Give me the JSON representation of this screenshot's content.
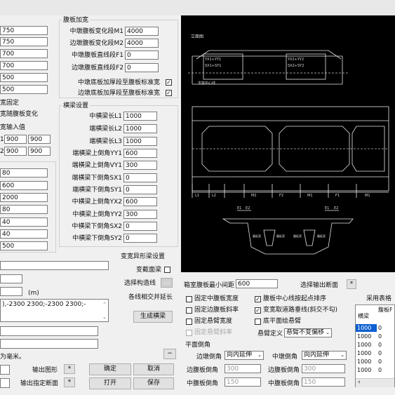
{
  "left_inputs": [
    "750",
    "750",
    "700",
    "700",
    "500",
    "500"
  ],
  "left_labels": {
    "fixed_width": "宽固定",
    "width_follow": "宽随腹板变化",
    "width_input": "宽输入值",
    "row1_prefix": "1",
    "row2_prefix": "2"
  },
  "width_pairs": [
    [
      "900",
      "900"
    ],
    [
      "900",
      "900"
    ]
  ],
  "left_column_inputs": [
    "80",
    "600",
    "2000",
    "80",
    "40",
    "40",
    "500"
  ],
  "web_haunch": {
    "title": "腹板加宽",
    "rows": [
      {
        "label": "中墩腹板变化段M1",
        "value": "4000"
      },
      {
        "label": "边墩腹板变化段M2",
        "value": "4000"
      },
      {
        "label": "中墩腹板直线段F1",
        "value": "0"
      },
      {
        "label": "边墩腹板直线段F2",
        "value": "0"
      }
    ],
    "checks": [
      {
        "label": "中墩底板加厚段至腹板标准宽",
        "checked": "✓"
      },
      {
        "label": "边墩底板加厚段至腹板标准宽",
        "checked": "✓"
      }
    ]
  },
  "diaphragm": {
    "title": "横梁设置",
    "rows": [
      {
        "label": "中横梁长L1",
        "value": "1000"
      },
      {
        "label": "端横梁长L2",
        "value": "1000"
      },
      {
        "label": "端横梁长L3",
        "value": "1000"
      },
      {
        "label": "端横梁上倒角YY1",
        "value": "600"
      },
      {
        "label": "端横梁上倒角VY1",
        "value": "300"
      },
      {
        "label": "端横梁下倒角SX1",
        "value": "0"
      },
      {
        "label": "端横梁下倒角SY1",
        "value": "0"
      },
      {
        "label": "中横梁上倒角YX2",
        "value": "600"
      },
      {
        "label": "中横梁上倒角YY2",
        "value": "300"
      },
      {
        "label": "中横梁下倒角SX2",
        "value": "0"
      },
      {
        "label": "中横梁下倒角SY2",
        "value": "0"
      }
    ]
  },
  "variable_section": {
    "title": "变宽异形梁设置",
    "cross_section_label": "变截面梁",
    "select_line_label": "选择构造线",
    "select_line_btn": "...",
    "extend_label": "各线相交并延长",
    "generate_btn": "生成横梁"
  },
  "unit_hint": "(m)",
  "long_text": "),-2300 2300;-2300 2300;-",
  "unit_note": "为毫米。",
  "bottom_left": {
    "output_graph": "输出图形",
    "output_section": "输出指定断面",
    "star": "*",
    "ok": "确定",
    "cancel": "取消",
    "open": "打开",
    "save": "保存",
    "minus": "−"
  },
  "bottom_mid": {
    "min_gap_label": "箱室腹板最小间距",
    "min_gap_value": "600",
    "select_output_label": "选择输出断面",
    "star": "*",
    "checks": [
      {
        "label": "固定中腹板宽度",
        "checked": ""
      },
      {
        "label": "腹板中心线按起点排序",
        "checked": "✓"
      },
      {
        "label": "固定边腹板斜率",
        "checked": ""
      },
      {
        "label": "变宽取道路垂线(斜交不勾)",
        "checked": "✓"
      },
      {
        "label": "固定悬臂宽度",
        "checked": ""
      },
      {
        "label": "底平面绘悬臂",
        "checked": ""
      },
      {
        "label": "固定悬臂斜率",
        "checked": ""
      }
    ],
    "cantilever_label": "悬臂定义",
    "cantilever_value": "悬臂不变偏移",
    "plane_chamfer": "平面倒角",
    "edge_pier_chamfer": "边墩倒角",
    "mid_pier_chamfer": "中墩倒角",
    "chamfer_mode": "向内延伸",
    "edge_web_chamfer": "边腹板倒角",
    "edge_web_value": "300",
    "edge_web_chamfer2": "边腹板倒角",
    "edge_web_value2": "300",
    "mid_web_chamfer": "中腹板倒角",
    "mid_web_value": "150",
    "mid_web_chamfer2": "中腹板倒角",
    "mid_web_value2": "150"
  },
  "table": {
    "caption": "采用表格",
    "headers": [
      "横梁",
      "腹板F"
    ],
    "rows": [
      [
        "1000",
        "0"
      ],
      [
        "1000",
        "0"
      ],
      [
        "1000",
        "0"
      ],
      [
        "1000",
        "0"
      ],
      [
        "1000",
        "0"
      ],
      [
        "1000",
        "0"
      ]
    ]
  },
  "cad": {
    "top_title": "立面图",
    "labels": [
      "YX1+YY1",
      "SX1+SY1",
      "YX2+YY2",
      "SX2+SY2",
      "支座中心线"
    ],
    "dims": [
      "L1",
      "L2",
      "M2",
      "F2",
      "M1",
      "F1",
      "M1"
    ],
    "section_labels": [
      "E1",
      "E2",
      "E1",
      "E2"
    ],
    "sec_texts": [
      "腹板宽",
      "腹板宽",
      "腹板宽",
      "腹板宽"
    ]
  }
}
